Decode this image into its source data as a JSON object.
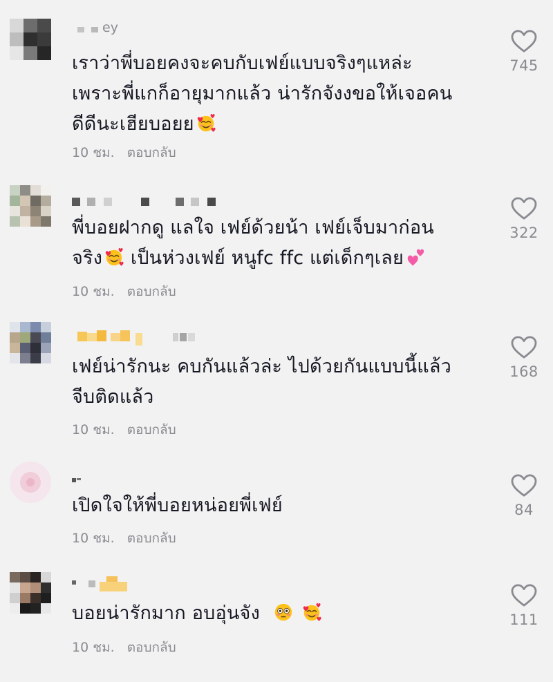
{
  "comments": [
    {
      "username": "ey",
      "lines": [
        "เราว่าพี่บอยคงจะคบกับเฟย์แบบจริงๆแหล่ะ",
        "เพราะพี่แกก็อายุมากแล้ว น่ารักจังงขอให้เจอคน",
        "ดีดีนะเฮียบอยย"
      ],
      "time": "10 ชม.",
      "reply": "ตอบกลับ",
      "likes": "745"
    },
    {
      "username": "",
      "lines": [
        "พี่บอยฝากดู แลใจ เฟย์ด้วยน้า เฟย์เจ็บมาก่อน",
        "จริง",
        "เป็นห่วงเฟย์ หนูfc ffc แต่เด็กๆเลย"
      ],
      "time": "10 ชม.",
      "reply": "ตอบกลับ",
      "likes": "322"
    },
    {
      "username": "",
      "lines": [
        "เฟย์น่ารักนะ คบกันแล้วล่ะ ไปด้วยกันแบบนี้แล้ว",
        "จีบติดแล้ว"
      ],
      "time": "10 ชม.",
      "reply": "ตอบกลับ",
      "likes": "168"
    },
    {
      "username": "",
      "lines": [
        "เปิดใจให้พี่บอยหน่อยพี่เฟย์"
      ],
      "time": "10 ชม.",
      "reply": "ตอบกลับ",
      "likes": "84"
    },
    {
      "username": "",
      "lines": [
        "บอยน่ารักมาก อบอุ่นจัง"
      ],
      "time": "10 ชม.",
      "reply": "ตอบกลับ",
      "likes": "111"
    }
  ],
  "icons": {
    "like": "heart-outline-icon",
    "smiling_hearts": "smiling-face-with-hearts-emoji",
    "two_hearts": "two-hearts-emoji",
    "flushed": "flushed-face-emoji"
  },
  "colors": {
    "background": "#f2f2f2",
    "text": "#161823",
    "secondary": "#8a8b91"
  }
}
